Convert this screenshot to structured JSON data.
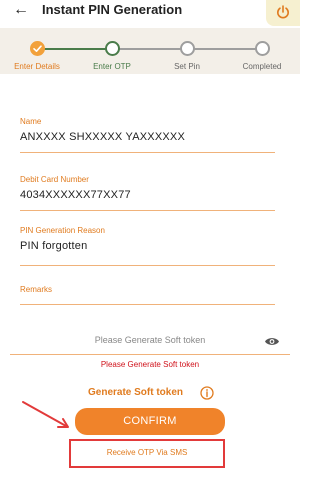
{
  "header": {
    "title": "Instant PIN Generation"
  },
  "stepper": {
    "steps": [
      {
        "label": "Enter Details",
        "state": "done"
      },
      {
        "label": "Enter OTP",
        "state": "active"
      },
      {
        "label": "Set Pin",
        "state": "pending"
      },
      {
        "label": "Completed",
        "state": "pending"
      }
    ]
  },
  "form": {
    "name": {
      "label": "Name",
      "value": "ANXXXX SHXXXXX YAXXXXXX"
    },
    "debit_card": {
      "label": "Debit Card Number",
      "value": "4034XXXXXX77XX77"
    },
    "reason": {
      "label": "PIN Generation Reason",
      "value": "PIN forgotten"
    },
    "remarks": {
      "label": "Remarks",
      "value": ""
    },
    "soft_token": {
      "placeholder": "Please Generate Soft token"
    },
    "error": "Please Generate Soft token"
  },
  "actions": {
    "generate_soft_token": "Generate Soft token",
    "confirm": "CONFIRM",
    "receive_otp": "Receive OTP Via SMS"
  },
  "colors": {
    "accent": "#f0832a",
    "accent_text": "#e07b1f",
    "step_done": "#f2a13b",
    "step_active": "#4a7c4a",
    "step_pending": "#9e9e9e",
    "error": "#d0121b",
    "highlight_box": "#e23a3a"
  }
}
